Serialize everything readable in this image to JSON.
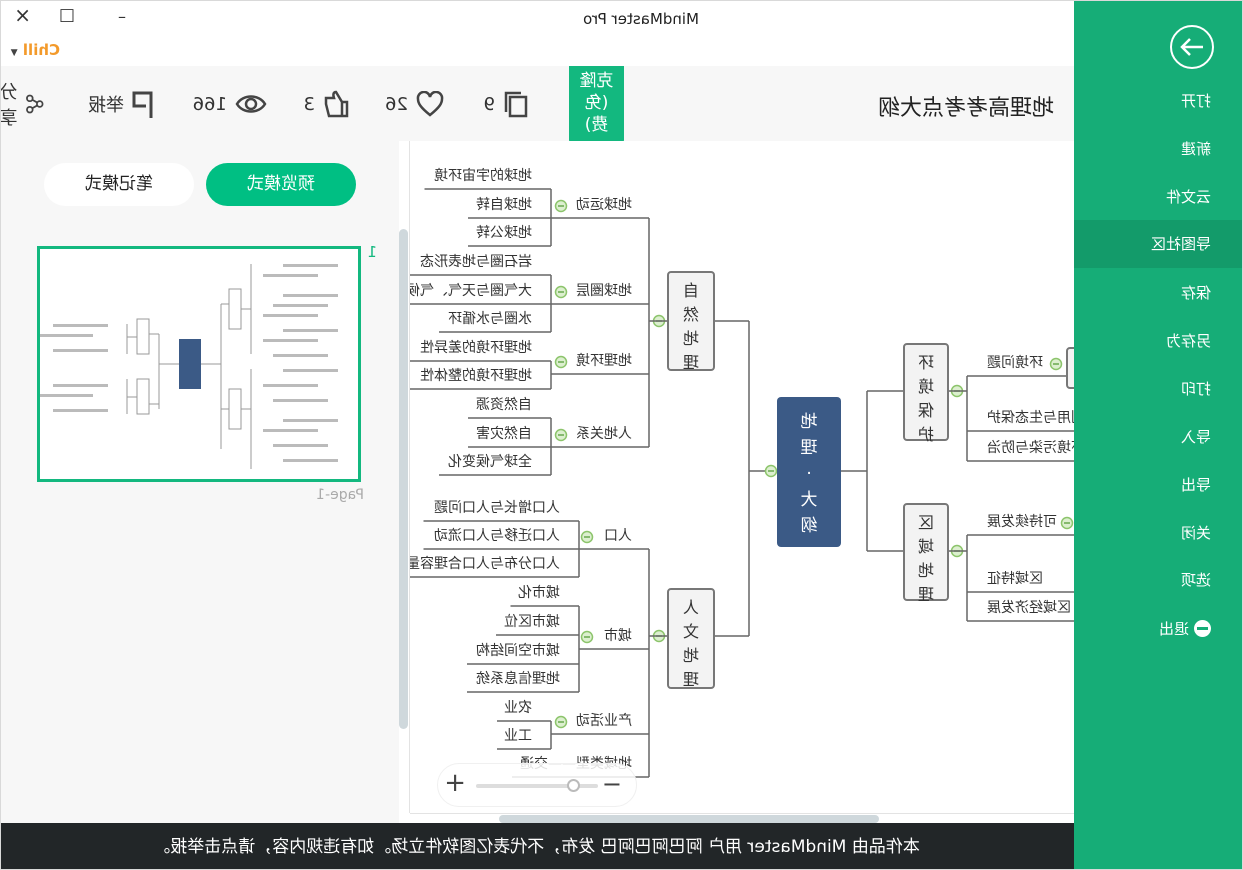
{
  "window": {
    "title": "MindMaster Pro",
    "user": "Chill",
    "controls": {
      "close": "×",
      "maximize": "□",
      "minimize": "–"
    }
  },
  "sidebar": {
    "back_icon": "arrow-right-circle-icon",
    "items": [
      {
        "label": "打开"
      },
      {
        "label": "新建"
      },
      {
        "label": "云文件"
      },
      {
        "label": "导图社区",
        "selected": true
      },
      {
        "label": "保存"
      },
      {
        "label": "另存为"
      },
      {
        "label": "打印"
      },
      {
        "label": "导入"
      },
      {
        "label": "导出"
      },
      {
        "label": "关闭"
      },
      {
        "label": "选项"
      },
      {
        "label": "退出",
        "icon": "minus-circle-icon"
      }
    ],
    "color": "#16ad77",
    "selected_color": "#139b6a"
  },
  "header": {
    "title": "地理高考考点大纲",
    "clone_label": "克隆(免费)",
    "copies": "9",
    "favorites": "26",
    "likes": "3",
    "views": "166",
    "report_label": "举报",
    "share_label": "分享"
  },
  "left_panel": {
    "preview_mode": "预览模式",
    "note_mode": "笔记模式",
    "page_number": "1",
    "page_label": "Page-1"
  },
  "mindmap": {
    "root": "地理·大纲",
    "branches": [
      {
        "label": "自然地理",
        "children": [
          {
            "label": "地球运动",
            "children": [
              "地球的宇宙环境",
              "地球自转",
              "地球公转"
            ]
          },
          {
            "label": "地球圈层",
            "children": [
              "岩石圈与地表形态",
              "大气圈与天气、气候",
              "水圈与水循环"
            ]
          },
          {
            "label": "地理环境",
            "children": [
              "地理环境的差异性",
              "地理环境的整体性"
            ]
          },
          {
            "label": "人地关系",
            "children": [
              "自然资源",
              "自然灾害",
              "全球气候变化"
            ]
          }
        ]
      },
      {
        "label": "人文地理",
        "children": [
          {
            "label": "人口",
            "children": [
              "人口增长与人口问题",
              "人口迁移与人口流动",
              "人口分布与人口合理容量"
            ]
          },
          {
            "label": "城市",
            "children": [
              "城市化",
              "城市区位",
              "城市空间结构",
              "地理信息系统"
            ]
          },
          {
            "label": "产业活动",
            "children": [
              "农业",
              "工业"
            ]
          },
          {
            "label": "地域类型——交通",
            "children": []
          }
        ]
      },
      {
        "label": "环境保护",
        "children": [
          {
            "label": "环境问题"
          },
          {
            "label": "资源利用与生态保护"
          },
          {
            "label": "环境污染与防治"
          }
        ]
      },
      {
        "label": "区域地理",
        "children": [
          {
            "label": "可持续发展"
          },
          {
            "label": "区域特征"
          },
          {
            "label": "区域经济发展"
          }
        ]
      }
    ],
    "root_color": "#3b5a86"
  },
  "zoom": {
    "minus": "−",
    "plus": "+",
    "level_fraction": 0.2
  },
  "footer": {
    "notice": "本作品由 MindMaster 用户 阿巴阿巴阿巴 发布，不代表亿图软件立场。如有违规内容，请点击举报。"
  }
}
